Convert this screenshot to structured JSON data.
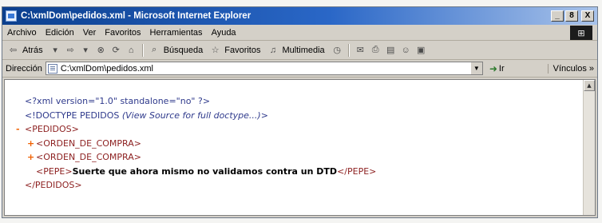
{
  "window": {
    "title": "C:\\xmlDom\\pedidos.xml - Microsoft Internet Explorer",
    "controls": {
      "minimize": "_",
      "maximize": "8",
      "close": "X"
    }
  },
  "menu": {
    "items": [
      {
        "label": "Archivo"
      },
      {
        "label": "Edición"
      },
      {
        "label": "Ver"
      },
      {
        "label": "Favoritos"
      },
      {
        "label": "Herramientas"
      },
      {
        "label": "Ayuda"
      }
    ]
  },
  "toolbar": {
    "back_label": "Atrás",
    "search_label": "Búsqueda",
    "favorites_label": "Favoritos",
    "multimedia_label": "Multimedia"
  },
  "address": {
    "label": "Dirección",
    "value": "C:\\xmlDom\\pedidos.xml",
    "go_label": "Ir",
    "links_label": "Vínculos »"
  },
  "xml": {
    "declaration": "<?xml version=\"1.0\" standalone=\"no\" ?>",
    "doctype_open": "<!DOCTYPE PEDIDOS ",
    "doctype_note": "(View Source for full doctype...)",
    "doctype_close": ">",
    "root_sym": "-",
    "root_open": "<PEDIDOS>",
    "child1_sym": "+",
    "child1": "<ORDEN_DE_COMPRA>",
    "child2_sym": "+",
    "child2": "<ORDEN_DE_COMPRA>",
    "pepe_open": "<PEPE>",
    "pepe_text": "Suerte que ahora mismo no validamos contra un DTD",
    "pepe_close": "</PEPE>",
    "root_close": "</PEDIDOS>"
  },
  "colors": {
    "titlebar": "#0b3f8e",
    "tag": "#8c1f1f",
    "declaration": "#2f3a8c",
    "collapse_symbol": "#f06000"
  }
}
